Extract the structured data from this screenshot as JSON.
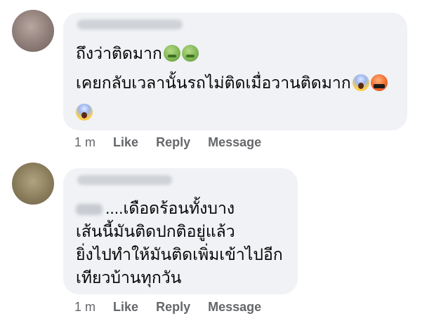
{
  "comments": [
    {
      "lines": [
        "ถึงว่าติดมาก",
        "เคยกลับเวลานั้นรถไม่ติดเมื่อวานติดมาก",
        ""
      ],
      "time": "1 m",
      "like_label": "Like",
      "reply_label": "Reply",
      "message_label": "Message"
    },
    {
      "lines": [
        "....เดือดร้อนทั้งบาง",
        "เส้นนี้มันติดปกติอยู่แล้ว",
        "ยิ่งไปทำให้มันติดเพิ่มเข้าไปอีก",
        "เทียวบ้านทุกวัน"
      ],
      "time": "1 m",
      "like_label": "Like",
      "reply_label": "Reply",
      "message_label": "Message"
    }
  ],
  "emoji_icons": [
    "nauseated-face-icon",
    "face-screaming-in-fear-icon",
    "face-with-symbols-on-mouth-icon"
  ],
  "colors": {
    "bubble": "#f0f2f5",
    "text": "#050505",
    "meta": "#65676b"
  }
}
